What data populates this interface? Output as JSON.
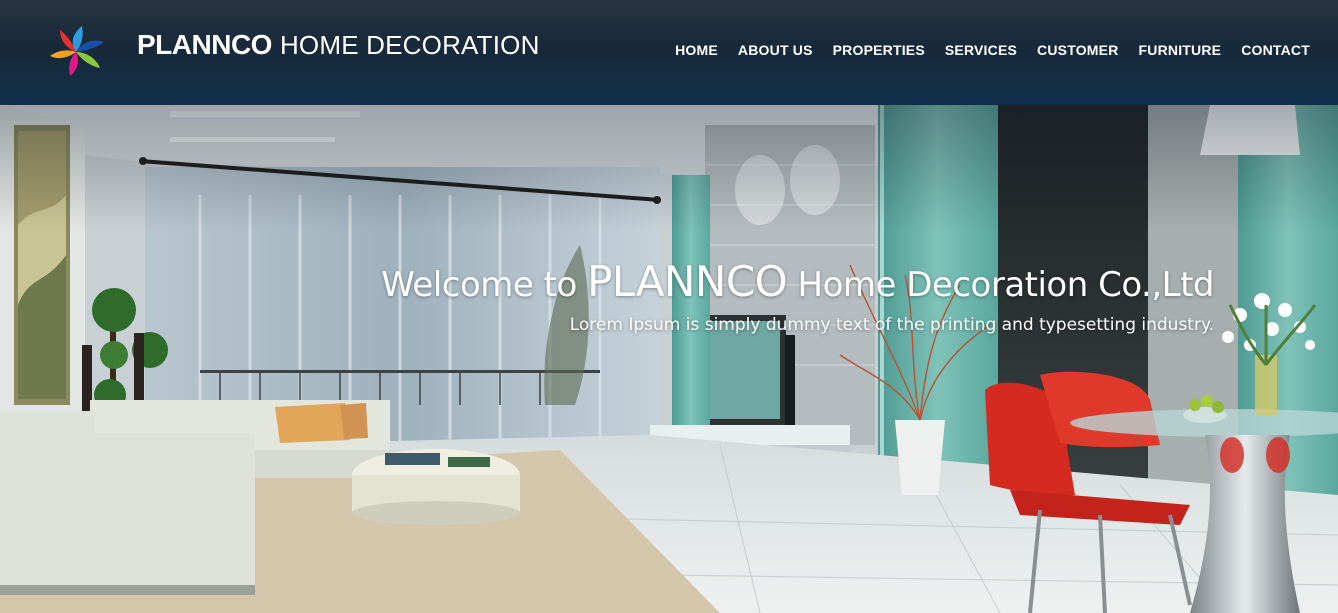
{
  "header": {
    "brand_bold": "PLANNCO",
    "brand_light": "HOME DECORATION",
    "logo_icon": "pinwheel-logo-icon"
  },
  "nav": {
    "items": [
      {
        "label": "HOME"
      },
      {
        "label": "ABOUT US"
      },
      {
        "label": "PROPERTIES"
      },
      {
        "label": "SERVICES"
      },
      {
        "label": "CUSTOMER"
      },
      {
        "label": "FURNITURE"
      },
      {
        "label": "CONTACT"
      }
    ]
  },
  "hero": {
    "title_prefix": "Welcome to ",
    "title_brand": "PLANNCO",
    "title_suffix": " Home Decoration Co.,Ltd",
    "subtitle": "Lorem Ipsum is simply dummy text of the printing and typesetting industry."
  },
  "colors": {
    "header_bg": "#17293a",
    "nav_text": "#ffffff",
    "teal_panel": "#5faaa0",
    "chair_red": "#d42a20"
  }
}
